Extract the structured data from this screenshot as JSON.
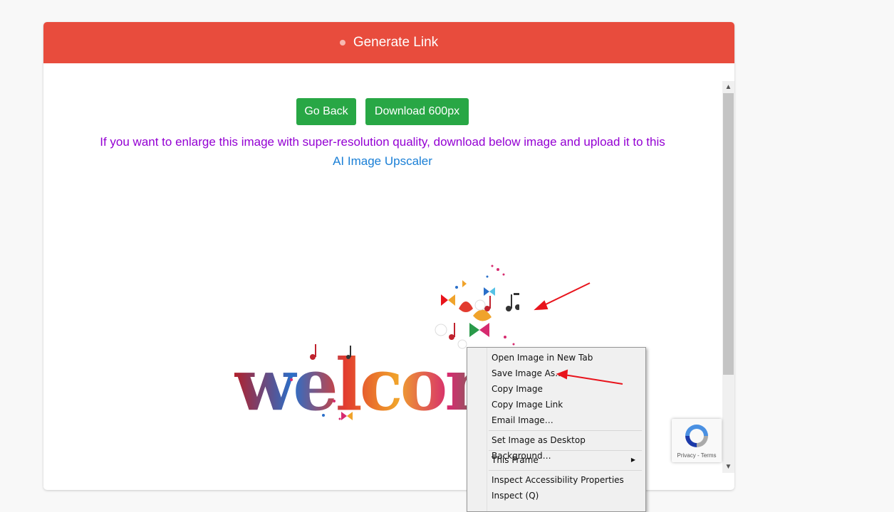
{
  "header": {
    "title": "Generate Link"
  },
  "buttons": {
    "go_back": "Go Back",
    "download": "Download 600px"
  },
  "info": {
    "text": "If you want to enlarge this image with super-resolution quality, download below image and upload it to this",
    "link": "AI Image Upscaler"
  },
  "image": {
    "text": "welcome"
  },
  "recaptcha": {
    "links": "Privacy - Terms"
  },
  "context_menu": {
    "items": [
      "Open Image in New Tab",
      "Save Image As…",
      "Copy Image",
      "Copy Image Link",
      "Email Image…",
      "Set Image as Desktop Background…",
      "This Frame",
      "Inspect Accessibility Properties",
      "Inspect (Q)"
    ]
  },
  "colors": {
    "header": "#e84c3d",
    "button": "#28a745",
    "info_text": "#9400d3",
    "link": "#1a7fd6",
    "annotation": "#e8141c"
  }
}
